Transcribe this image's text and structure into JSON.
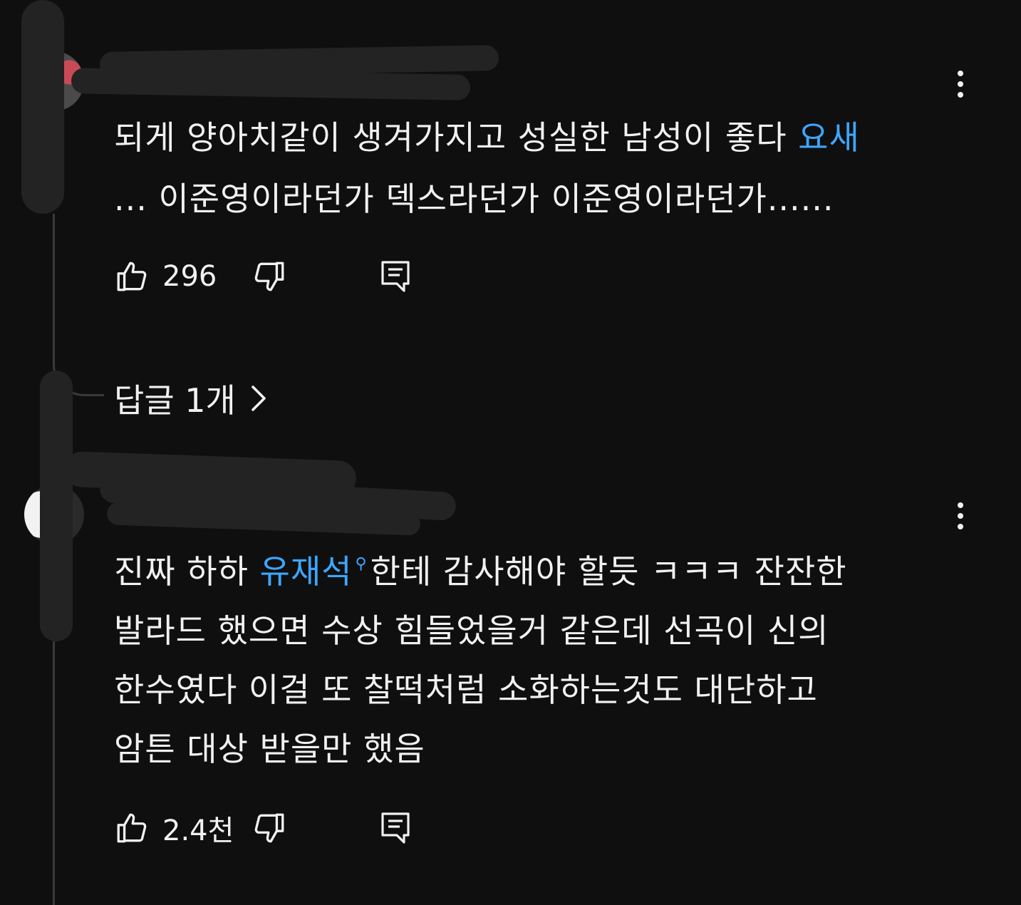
{
  "comments": [
    {
      "lines": [
        {
          "text": "되게 양아치같이 생겨가지고 성실한 남성이 좋다 ",
          "link": "요새"
        },
        {
          "text": "... 이준영이라던가 덱스라던가 이준영이라던가......",
          "link": ""
        }
      ],
      "likes": "296",
      "replies_label": "답글 1개"
    },
    {
      "line1_before": "진짜 하하 ",
      "line1_link": "유재석",
      "line1_after": "한테 감사해야 할듯 ㅋㅋㅋ 잔잔한",
      "lines_rest": [
        "발라드 했으면 수상 힘들었을거 같은데 선곡이 신의",
        "한수였다  이걸 또 찰떡처럼 소화하는것도 대단하고",
        "암튼 대상 받을만 했음"
      ],
      "likes": "2.4천"
    }
  ],
  "icons": {
    "like": "thumbs-up-icon",
    "dislike": "thumbs-down-icon",
    "reply": "comment-reply-icon",
    "more": "more-vert-icon",
    "chevron": "chevron-right-icon",
    "search": "search-icon"
  },
  "colors": {
    "background": "#0f0f0f",
    "text": "#f1f1f1",
    "link": "#3ea6ff"
  }
}
